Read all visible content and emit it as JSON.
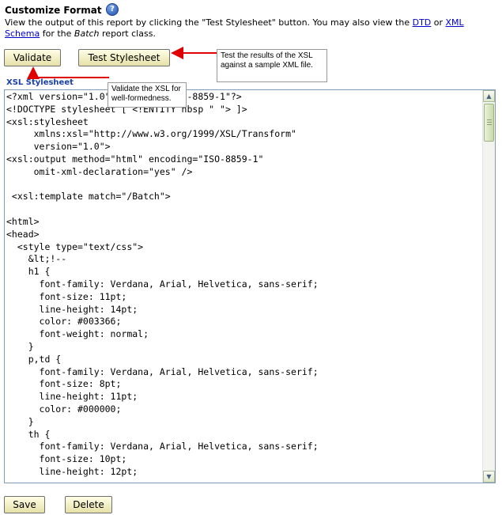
{
  "header": {
    "title": "Customize Format",
    "desc_line1_prefix": "View the output of this report by clicking the \"Test Stylesheet\" button. You may also view the ",
    "dtd_link": "DTD",
    "desc_or": " or ",
    "xml_schema_link": "XML Schema",
    "desc_for_the": " for the ",
    "batch": "Batch",
    "desc_suffix": " report class."
  },
  "toolbar": {
    "validate_label": "Validate",
    "test_label": "Test Stylesheet"
  },
  "callouts": {
    "test": "Test the results of the XSL against a sample XML file.",
    "validate": "Validate the XSL for well-formedness."
  },
  "editor": {
    "label": "XSL Stylesheet",
    "code": "<?xml version=\"1.0\" encoding=\"ISO-8859-1\"?>\n<!DOCTYPE stylesheet [ <!ENTITY nbsp \" \"> ]>\n<xsl:stylesheet\n     xmlns:xsl=\"http://www.w3.org/1999/XSL/Transform\"\n     version=\"1.0\">\n<xsl:output method=\"html\" encoding=\"ISO-8859-1\"\n     omit-xml-declaration=\"yes\" />\n\n <xsl:template match=\"/Batch\">\n\n<html>\n<head>\n  <style type=\"text/css\">\n    &lt;!--\n    h1 {\n      font-family: Verdana, Arial, Helvetica, sans-serif;\n      font-size: 11pt;\n      line-height: 14pt;\n      color: #003366;\n      font-weight: normal;\n    }\n    p,td {\n      font-family: Verdana, Arial, Helvetica, sans-serif;\n      font-size: 8pt;\n      line-height: 11pt;\n      color: #000000;\n    }\n    th {\n      font-family: Verdana, Arial, Helvetica, sans-serif;\n      font-size: 10pt;\n      line-height: 12pt;"
  },
  "footer": {
    "save_label": "Save",
    "delete_label": "Delete"
  },
  "colors": {
    "accent_link": "#0000cc",
    "label_blue": "#1a3fa6",
    "arrow_red": "#e00000",
    "button_bg": "#fffee6"
  }
}
